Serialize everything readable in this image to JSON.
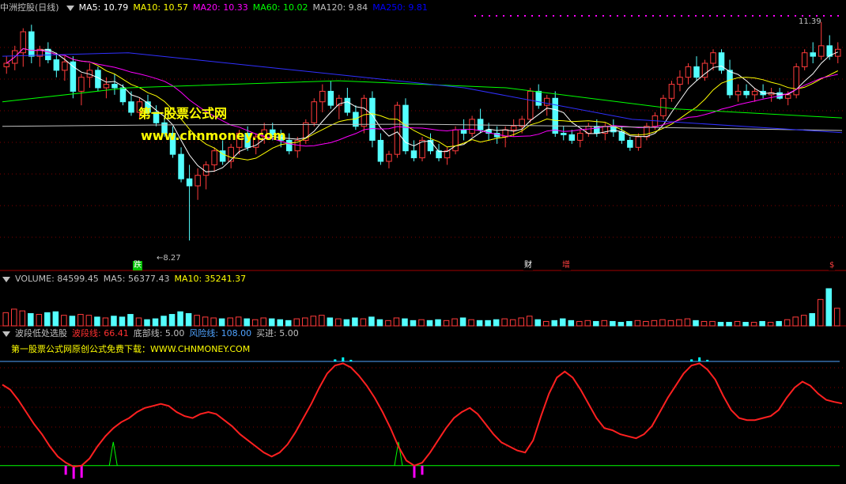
{
  "main_panel": {
    "title": "中洲控股(日线)",
    "indicators": [
      {
        "label": "MA5: 10.79",
        "color": "#ffffff"
      },
      {
        "label": "MA10: 10.57",
        "color": "#ffff00"
      },
      {
        "label": "MA20: 10.33",
        "color": "#ff00ff"
      },
      {
        "label": "MA60: 10.02",
        "color": "#00ff00"
      },
      {
        "label": "MA120: 9.84",
        "color": "#c0c0c0"
      },
      {
        "label": "MA250: 9.81",
        "color": "#0000ff"
      }
    ],
    "high_label": "11.39",
    "low_label": "8.27",
    "watermark_cn": "第一股票公式网",
    "watermark_url": "www.chnmoney.com",
    "markers": [
      {
        "text": "跌",
        "bg": "#00c000",
        "color": "#ffffff"
      },
      {
        "text": "财",
        "bg": "#000000",
        "color": "#ffffff"
      },
      {
        "text": "增",
        "bg": "#000000",
        "color": "#ff4040"
      },
      {
        "text": "$",
        "bg": "#000000",
        "color": "#ff4040"
      }
    ]
  },
  "volume_panel": {
    "labels": [
      {
        "label": "VOLUME: 84599.45",
        "color": "#c0c0c0"
      },
      {
        "label": "MA5: 56377.43",
        "color": "#c0c0c0"
      },
      {
        "label": "MA10: 35241.37",
        "color": "#ffff00"
      }
    ]
  },
  "indicator_panel": {
    "labels": [
      {
        "label": "波段低处选股",
        "color": "#c0c0c0"
      },
      {
        "label": "波段线: 66.41",
        "color": "#ff3030"
      },
      {
        "label": "底部线: 5.00",
        "color": "#c0c0c0"
      },
      {
        "label": "风险线: 108.00",
        "color": "#4fa3ff"
      },
      {
        "label": "买进: 5.00",
        "color": "#c0c0c0"
      }
    ],
    "subtitle": "第一股票公式网原创公式免费下载：WWW.CHNMONEY.COM"
  },
  "colors": {
    "up": "#ff3b3b",
    "down": "#54ffff",
    "wave": "#ff2020",
    "bottom_line": "#00ff00",
    "risk_line": "#4fa3ff",
    "buy": "#ff00ff",
    "peak": "#00ffff",
    "grid": "#800000"
  },
  "chart_data": [
    {
      "type": "candlestick",
      "title": "中洲控股(日线)",
      "price_range": [
        8.27,
        11.39
      ],
      "ohlc": [
        [
          10.75,
          10.9,
          10.65,
          10.8
        ],
        [
          10.8,
          11.05,
          10.7,
          10.98
        ],
        [
          10.95,
          11.3,
          10.75,
          11.25
        ],
        [
          11.25,
          11.35,
          10.8,
          10.9
        ],
        [
          10.9,
          11.05,
          10.75,
          11.0
        ],
        [
          11.0,
          11.1,
          10.8,
          10.85
        ],
        [
          10.85,
          10.95,
          10.6,
          10.7
        ],
        [
          10.7,
          10.9,
          10.55,
          10.82
        ],
        [
          10.82,
          10.9,
          10.3,
          10.4
        ],
        [
          10.4,
          10.65,
          10.2,
          10.6
        ],
        [
          10.6,
          10.8,
          10.45,
          10.7
        ],
        [
          10.7,
          10.75,
          10.4,
          10.45
        ],
        [
          10.45,
          10.6,
          10.3,
          10.5
        ],
        [
          10.5,
          10.65,
          10.35,
          10.45
        ],
        [
          10.45,
          10.5,
          10.2,
          10.25
        ],
        [
          10.25,
          10.4,
          10.05,
          10.1
        ],
        [
          10.1,
          10.3,
          10.0,
          10.25
        ],
        [
          10.25,
          10.35,
          10.05,
          10.1
        ],
        [
          10.1,
          10.2,
          9.9,
          9.95
        ],
        [
          9.95,
          10.05,
          9.75,
          9.8
        ],
        [
          9.8,
          9.9,
          9.45,
          9.5
        ],
        [
          9.5,
          9.6,
          9.1,
          9.15
        ],
        [
          9.15,
          9.35,
          8.27,
          9.05
        ],
        [
          9.05,
          9.3,
          8.85,
          9.2
        ],
        [
          9.2,
          9.4,
          9.0,
          9.35
        ],
        [
          9.35,
          9.6,
          9.25,
          9.55
        ],
        [
          9.55,
          9.7,
          9.35,
          9.4
        ],
        [
          9.4,
          9.65,
          9.3,
          9.6
        ],
        [
          9.6,
          9.85,
          9.5,
          9.8
        ],
        [
          9.8,
          9.9,
          9.55,
          9.6
        ],
        [
          9.6,
          9.8,
          9.5,
          9.75
        ],
        [
          9.75,
          9.95,
          9.65,
          9.85
        ],
        [
          9.85,
          9.95,
          9.7,
          9.78
        ],
        [
          9.78,
          9.85,
          9.6,
          9.7
        ],
        [
          9.7,
          9.8,
          9.5,
          9.55
        ],
        [
          9.55,
          9.75,
          9.45,
          9.7
        ],
        [
          9.7,
          10.0,
          9.65,
          9.95
        ],
        [
          9.95,
          10.3,
          9.9,
          10.25
        ],
        [
          10.25,
          10.5,
          10.1,
          10.4
        ],
        [
          10.4,
          10.55,
          10.15,
          10.2
        ],
        [
          10.2,
          10.35,
          10.0,
          10.3
        ],
        [
          10.3,
          10.45,
          10.05,
          10.1
        ],
        [
          10.1,
          10.2,
          9.85,
          9.9
        ],
        [
          9.9,
          10.35,
          9.8,
          10.3
        ],
        [
          10.3,
          10.4,
          9.6,
          9.7
        ],
        [
          9.7,
          9.8,
          9.35,
          9.4
        ],
        [
          9.4,
          9.55,
          9.3,
          9.5
        ],
        [
          9.5,
          10.25,
          9.45,
          10.2
        ],
        [
          10.2,
          10.3,
          9.5,
          9.55
        ],
        [
          9.55,
          9.7,
          9.4,
          9.45
        ],
        [
          9.45,
          9.75,
          9.4,
          9.7
        ],
        [
          9.7,
          9.8,
          9.5,
          9.55
        ],
        [
          9.55,
          9.65,
          9.4,
          9.45
        ],
        [
          9.45,
          9.6,
          9.35,
          9.55
        ],
        [
          9.55,
          9.9,
          9.5,
          9.85
        ],
        [
          9.85,
          10.0,
          9.7,
          9.8
        ],
        [
          9.8,
          10.05,
          9.75,
          10.0
        ],
        [
          10.0,
          10.15,
          9.8,
          9.85
        ],
        [
          9.85,
          9.95,
          9.7,
          9.8
        ],
        [
          9.8,
          9.9,
          9.65,
          9.75
        ],
        [
          9.75,
          9.9,
          9.6,
          9.85
        ],
        [
          9.85,
          10.0,
          9.75,
          9.9
        ],
        [
          9.9,
          10.05,
          9.8,
          10.0
        ],
        [
          10.0,
          10.45,
          9.95,
          10.4
        ],
        [
          10.4,
          10.5,
          10.15,
          10.2
        ],
        [
          10.2,
          10.35,
          10.05,
          10.3
        ],
        [
          10.3,
          10.4,
          9.75,
          9.8
        ],
        [
          9.8,
          9.9,
          9.7,
          9.78
        ],
        [
          9.78,
          9.85,
          9.65,
          9.7
        ],
        [
          9.7,
          9.85,
          9.6,
          9.8
        ],
        [
          9.8,
          9.95,
          9.75,
          9.9
        ],
        [
          9.9,
          10.0,
          9.75,
          9.8
        ],
        [
          9.8,
          9.95,
          9.7,
          9.9
        ],
        [
          9.9,
          10.0,
          9.75,
          9.82
        ],
        [
          9.82,
          9.9,
          9.65,
          9.7
        ],
        [
          9.7,
          9.75,
          9.55,
          9.6
        ],
        [
          9.6,
          9.8,
          9.55,
          9.75
        ],
        [
          9.75,
          9.95,
          9.7,
          9.9
        ],
        [
          9.9,
          10.1,
          9.85,
          10.05
        ],
        [
          10.05,
          10.35,
          10.0,
          10.3
        ],
        [
          10.3,
          10.55,
          10.25,
          10.5
        ],
        [
          10.5,
          10.7,
          10.4,
          10.6
        ],
        [
          10.6,
          10.8,
          10.5,
          10.75
        ],
        [
          10.75,
          10.9,
          10.55,
          10.6
        ],
        [
          10.6,
          10.85,
          10.55,
          10.8
        ],
        [
          10.8,
          11.0,
          10.7,
          10.95
        ],
        [
          10.95,
          11.0,
          10.65,
          10.7
        ],
        [
          10.7,
          10.85,
          10.3,
          10.35
        ],
        [
          10.35,
          10.5,
          10.25,
          10.4
        ],
        [
          10.4,
          10.5,
          10.3,
          10.35
        ],
        [
          10.35,
          10.45,
          10.25,
          10.4
        ],
        [
          10.4,
          10.5,
          10.3,
          10.35
        ],
        [
          10.35,
          10.45,
          10.25,
          10.38
        ],
        [
          10.38,
          10.45,
          10.28,
          10.3
        ],
        [
          10.3,
          10.4,
          10.2,
          10.35
        ],
        [
          10.35,
          10.8,
          10.3,
          10.75
        ],
        [
          10.75,
          11.0,
          10.7,
          10.95
        ],
        [
          10.95,
          11.1,
          10.8,
          10.9
        ],
        [
          10.9,
          11.39,
          10.85,
          11.05
        ],
        [
          11.05,
          11.2,
          10.85,
          10.9
        ],
        [
          10.9,
          11.1,
          10.8,
          11.0
        ]
      ]
    },
    {
      "type": "bar",
      "title": "VOLUME",
      "values": [
        30,
        38,
        34,
        28,
        26,
        30,
        32,
        24,
        22,
        26,
        24,
        20,
        18,
        22,
        20,
        26,
        18,
        14,
        16,
        22,
        26,
        32,
        28,
        24,
        20,
        18,
        16,
        18,
        20,
        16,
        14,
        18,
        16,
        14,
        12,
        16,
        18,
        22,
        24,
        18,
        16,
        14,
        18,
        16,
        20,
        14,
        12,
        18,
        16,
        12,
        14,
        12,
        14,
        12,
        16,
        18,
        14,
        12,
        12,
        14,
        16,
        14,
        18,
        22,
        14,
        10,
        12,
        16,
        12,
        10,
        12,
        10,
        12,
        10,
        8,
        10,
        12,
        10,
        12,
        14,
        12,
        14,
        16,
        12,
        10,
        10,
        8,
        8,
        10,
        8,
        8,
        10,
        8,
        10,
        14,
        20,
        24,
        28,
        60,
        84.6,
        40
      ]
    },
    {
      "type": "line",
      "title": "波段低处选股",
      "series": [
        {
          "name": "波段线",
          "values": [
            85,
            80,
            70,
            58,
            46,
            36,
            24,
            14,
            8,
            4,
            5,
            12,
            24,
            34,
            42,
            48,
            52,
            58,
            62,
            64,
            66,
            64,
            58,
            54,
            52,
            56,
            58,
            56,
            50,
            44,
            36,
            30,
            24,
            18,
            14,
            18,
            26,
            38,
            52,
            66,
            82,
            96,
            104,
            106,
            102,
            94,
            84,
            72,
            58,
            42,
            24,
            10,
            5,
            8,
            18,
            30,
            42,
            52,
            58,
            62,
            56,
            46,
            36,
            28,
            24,
            20,
            18,
            30,
            54,
            76,
            92,
            98,
            92,
            80,
            66,
            52,
            42,
            40,
            36,
            34,
            32,
            36,
            44,
            58,
            72,
            84,
            96,
            104,
            106,
            100,
            90,
            74,
            60,
            52,
            50,
            50,
            52,
            54,
            60,
            72,
            82,
            88,
            84,
            76,
            70,
            68,
            66.41
          ]
        },
        {
          "name": "底部线",
          "values": [
            5
          ]
        },
        {
          "name": "风险线",
          "values": [
            108
          ]
        },
        {
          "name": "买进",
          "values": [
            5
          ]
        }
      ],
      "ylim": [
        -10,
        115
      ]
    }
  ]
}
